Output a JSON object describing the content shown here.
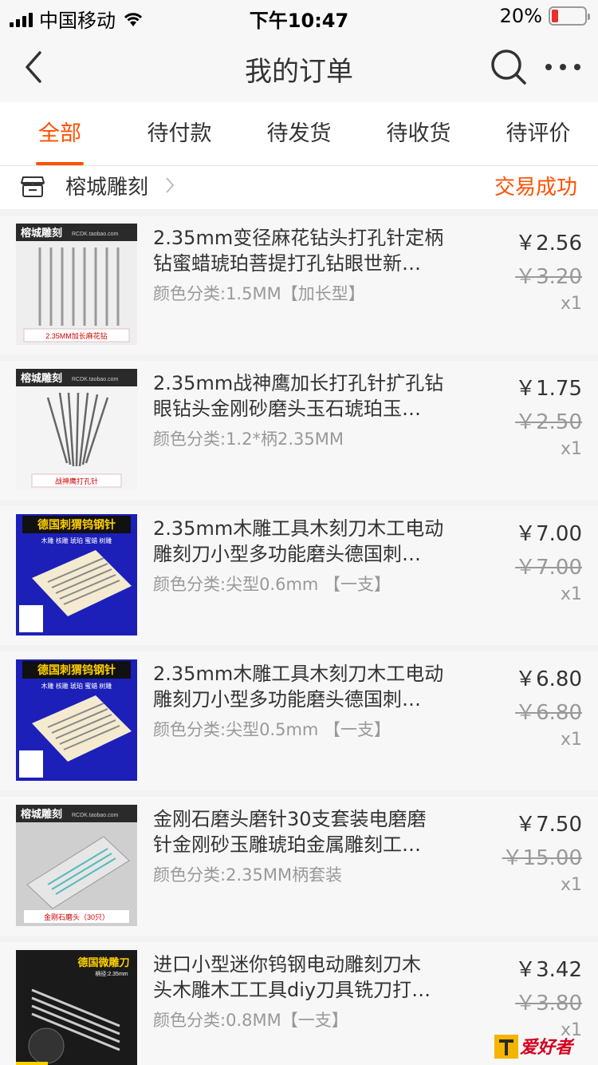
{
  "status_bar": {
    "carrier": "中国移动",
    "time": "下午10:47",
    "battery": "20%",
    "battery_level": 0.2,
    "battery_color": "#e8302c"
  },
  "nav": {
    "title": "我的订单",
    "back_icon": "chevron-left-icon",
    "search_icon": "search-icon",
    "more_icon": "more-icon"
  },
  "tabs": [
    {
      "label": "全部",
      "active": true
    },
    {
      "label": "待付款"
    },
    {
      "label": "待发货"
    },
    {
      "label": "待收货"
    },
    {
      "label": "待评价"
    }
  ],
  "shop": {
    "name": "榕城雕刻",
    "status": "交易成功",
    "accent": "#ff5000"
  },
  "items": [
    {
      "title_line1": "2.35mm变径麻花钻头打孔针定柄",
      "title_line2": "钻蜜蜡琥珀菩提打孔钻眼世新…",
      "sku": "颜色分类:1.5MM【加长型】",
      "price": "￥2.56",
      "original_price": "￥3.20",
      "qty": "x1",
      "thumb_brand": "榕城雕刻",
      "thumb_site": "RCDK.taobao.com",
      "thumb_caption": "2.35MM加长麻花钻"
    },
    {
      "title_line1": "2.35mm战神鹰加长打孔针扩孔钻",
      "title_line2": "眼钻头金刚砂磨头玉石琥珀玉…",
      "sku": "颜色分类:1.2*柄2.35MM",
      "price": "￥1.75",
      "original_price": "￥2.50",
      "qty": "x1",
      "thumb_brand": "榕城雕刻",
      "thumb_site": "RCDK.taobao.com",
      "thumb_caption": "战神鹰打孔针"
    },
    {
      "title_line1": "2.35mm木雕工具木刻刀木工电动",
      "title_line2": "雕刻刀小型多功能磨头德国刺…",
      "sku": "颜色分类:尖型0.6mm 【一支】",
      "price": "￥7.00",
      "original_price": "￥7.00",
      "qty": "x1",
      "thumb_brand": "德国刺猬钨钢针",
      "thumb_sub": "木雕 核雕 琥珀 蜜蜡 树雕"
    },
    {
      "title_line1": "2.35mm木雕工具木刻刀木工电动",
      "title_line2": "雕刻刀小型多功能磨头德国刺…",
      "sku": "颜色分类:尖型0.5mm 【一支】",
      "price": "￥6.80",
      "original_price": "￥6.80",
      "qty": "x1",
      "thumb_brand": "德国刺猬钨钢针",
      "thumb_sub": "木雕 核雕 琥珀 蜜蜡 树雕"
    },
    {
      "title_line1": "金刚石磨头磨针30支套装电磨磨",
      "title_line2": "针金刚砂玉雕琥珀金属雕刻工…",
      "sku": "颜色分类:2.35MM柄套装",
      "price": "￥7.50",
      "original_price": "￥15.00",
      "qty": "x1",
      "thumb_brand": "榕城雕刻",
      "thumb_site": "RCDK.taobao.com",
      "thumb_caption": "金刚石磨头（30只）"
    },
    {
      "title_line1": "进口小型迷你钨钢电动雕刻刀木",
      "title_line2": "头木雕木工工具diy刀具铣刀打…",
      "sku": "颜色分类:0.8MM【一支】",
      "price": "￥3.42",
      "original_price": "￥3.80",
      "qty": "x1",
      "thumb_brand": "德国微雕刀",
      "thumb_sub": "柄径:2.35mm"
    }
  ],
  "watermark": "爱好者"
}
